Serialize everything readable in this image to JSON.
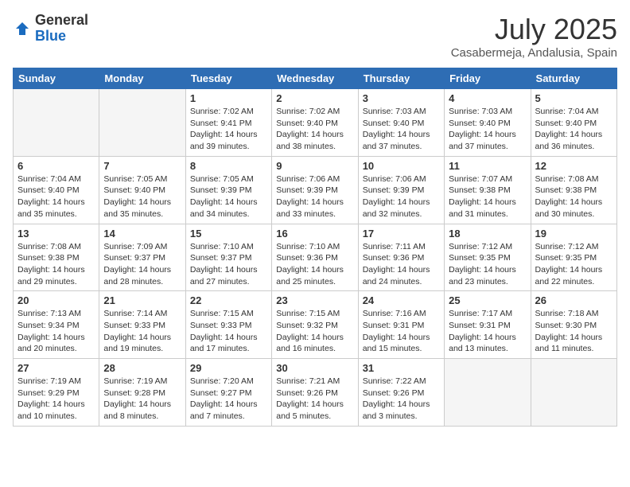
{
  "header": {
    "logo_general": "General",
    "logo_blue": "Blue",
    "month_title": "July 2025",
    "location": "Casabermeja, Andalusia, Spain"
  },
  "weekdays": [
    "Sunday",
    "Monday",
    "Tuesday",
    "Wednesday",
    "Thursday",
    "Friday",
    "Saturday"
  ],
  "weeks": [
    [
      {
        "day": "",
        "empty": true
      },
      {
        "day": "",
        "empty": true
      },
      {
        "day": "1",
        "sunrise": "Sunrise: 7:02 AM",
        "sunset": "Sunset: 9:41 PM",
        "daylight": "Daylight: 14 hours and 39 minutes."
      },
      {
        "day": "2",
        "sunrise": "Sunrise: 7:02 AM",
        "sunset": "Sunset: 9:40 PM",
        "daylight": "Daylight: 14 hours and 38 minutes."
      },
      {
        "day": "3",
        "sunrise": "Sunrise: 7:03 AM",
        "sunset": "Sunset: 9:40 PM",
        "daylight": "Daylight: 14 hours and 37 minutes."
      },
      {
        "day": "4",
        "sunrise": "Sunrise: 7:03 AM",
        "sunset": "Sunset: 9:40 PM",
        "daylight": "Daylight: 14 hours and 37 minutes."
      },
      {
        "day": "5",
        "sunrise": "Sunrise: 7:04 AM",
        "sunset": "Sunset: 9:40 PM",
        "daylight": "Daylight: 14 hours and 36 minutes."
      }
    ],
    [
      {
        "day": "6",
        "sunrise": "Sunrise: 7:04 AM",
        "sunset": "Sunset: 9:40 PM",
        "daylight": "Daylight: 14 hours and 35 minutes."
      },
      {
        "day": "7",
        "sunrise": "Sunrise: 7:05 AM",
        "sunset": "Sunset: 9:40 PM",
        "daylight": "Daylight: 14 hours and 35 minutes."
      },
      {
        "day": "8",
        "sunrise": "Sunrise: 7:05 AM",
        "sunset": "Sunset: 9:39 PM",
        "daylight": "Daylight: 14 hours and 34 minutes."
      },
      {
        "day": "9",
        "sunrise": "Sunrise: 7:06 AM",
        "sunset": "Sunset: 9:39 PM",
        "daylight": "Daylight: 14 hours and 33 minutes."
      },
      {
        "day": "10",
        "sunrise": "Sunrise: 7:06 AM",
        "sunset": "Sunset: 9:39 PM",
        "daylight": "Daylight: 14 hours and 32 minutes."
      },
      {
        "day": "11",
        "sunrise": "Sunrise: 7:07 AM",
        "sunset": "Sunset: 9:38 PM",
        "daylight": "Daylight: 14 hours and 31 minutes."
      },
      {
        "day": "12",
        "sunrise": "Sunrise: 7:08 AM",
        "sunset": "Sunset: 9:38 PM",
        "daylight": "Daylight: 14 hours and 30 minutes."
      }
    ],
    [
      {
        "day": "13",
        "sunrise": "Sunrise: 7:08 AM",
        "sunset": "Sunset: 9:38 PM",
        "daylight": "Daylight: 14 hours and 29 minutes."
      },
      {
        "day": "14",
        "sunrise": "Sunrise: 7:09 AM",
        "sunset": "Sunset: 9:37 PM",
        "daylight": "Daylight: 14 hours and 28 minutes."
      },
      {
        "day": "15",
        "sunrise": "Sunrise: 7:10 AM",
        "sunset": "Sunset: 9:37 PM",
        "daylight": "Daylight: 14 hours and 27 minutes."
      },
      {
        "day": "16",
        "sunrise": "Sunrise: 7:10 AM",
        "sunset": "Sunset: 9:36 PM",
        "daylight": "Daylight: 14 hours and 25 minutes."
      },
      {
        "day": "17",
        "sunrise": "Sunrise: 7:11 AM",
        "sunset": "Sunset: 9:36 PM",
        "daylight": "Daylight: 14 hours and 24 minutes."
      },
      {
        "day": "18",
        "sunrise": "Sunrise: 7:12 AM",
        "sunset": "Sunset: 9:35 PM",
        "daylight": "Daylight: 14 hours and 23 minutes."
      },
      {
        "day": "19",
        "sunrise": "Sunrise: 7:12 AM",
        "sunset": "Sunset: 9:35 PM",
        "daylight": "Daylight: 14 hours and 22 minutes."
      }
    ],
    [
      {
        "day": "20",
        "sunrise": "Sunrise: 7:13 AM",
        "sunset": "Sunset: 9:34 PM",
        "daylight": "Daylight: 14 hours and 20 minutes."
      },
      {
        "day": "21",
        "sunrise": "Sunrise: 7:14 AM",
        "sunset": "Sunset: 9:33 PM",
        "daylight": "Daylight: 14 hours and 19 minutes."
      },
      {
        "day": "22",
        "sunrise": "Sunrise: 7:15 AM",
        "sunset": "Sunset: 9:33 PM",
        "daylight": "Daylight: 14 hours and 17 minutes."
      },
      {
        "day": "23",
        "sunrise": "Sunrise: 7:15 AM",
        "sunset": "Sunset: 9:32 PM",
        "daylight": "Daylight: 14 hours and 16 minutes."
      },
      {
        "day": "24",
        "sunrise": "Sunrise: 7:16 AM",
        "sunset": "Sunset: 9:31 PM",
        "daylight": "Daylight: 14 hours and 15 minutes."
      },
      {
        "day": "25",
        "sunrise": "Sunrise: 7:17 AM",
        "sunset": "Sunset: 9:31 PM",
        "daylight": "Daylight: 14 hours and 13 minutes."
      },
      {
        "day": "26",
        "sunrise": "Sunrise: 7:18 AM",
        "sunset": "Sunset: 9:30 PM",
        "daylight": "Daylight: 14 hours and 11 minutes."
      }
    ],
    [
      {
        "day": "27",
        "sunrise": "Sunrise: 7:19 AM",
        "sunset": "Sunset: 9:29 PM",
        "daylight": "Daylight: 14 hours and 10 minutes."
      },
      {
        "day": "28",
        "sunrise": "Sunrise: 7:19 AM",
        "sunset": "Sunset: 9:28 PM",
        "daylight": "Daylight: 14 hours and 8 minutes."
      },
      {
        "day": "29",
        "sunrise": "Sunrise: 7:20 AM",
        "sunset": "Sunset: 9:27 PM",
        "daylight": "Daylight: 14 hours and 7 minutes."
      },
      {
        "day": "30",
        "sunrise": "Sunrise: 7:21 AM",
        "sunset": "Sunset: 9:26 PM",
        "daylight": "Daylight: 14 hours and 5 minutes."
      },
      {
        "day": "31",
        "sunrise": "Sunrise: 7:22 AM",
        "sunset": "Sunset: 9:26 PM",
        "daylight": "Daylight: 14 hours and 3 minutes."
      },
      {
        "day": "",
        "empty": true
      },
      {
        "day": "",
        "empty": true
      }
    ]
  ]
}
